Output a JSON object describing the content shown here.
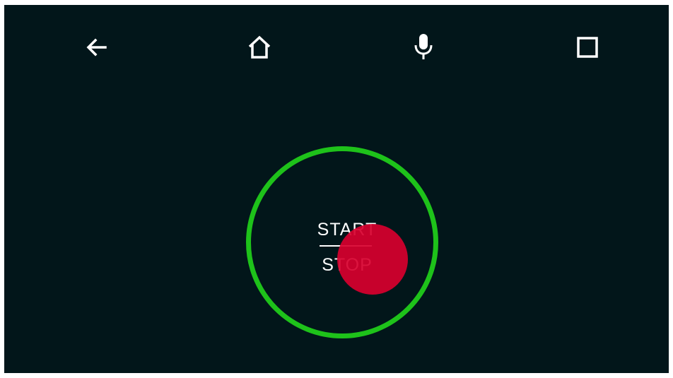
{
  "navbar": {
    "icons": [
      "back-arrow-icon",
      "home-icon",
      "microphone-icon",
      "overview-square-icon"
    ]
  },
  "control": {
    "start_label": "START",
    "stop_label": "STOP",
    "colors": {
      "ring": "#1ec21a",
      "touch_indicator": "#d8002e",
      "background": "#02161a"
    }
  }
}
